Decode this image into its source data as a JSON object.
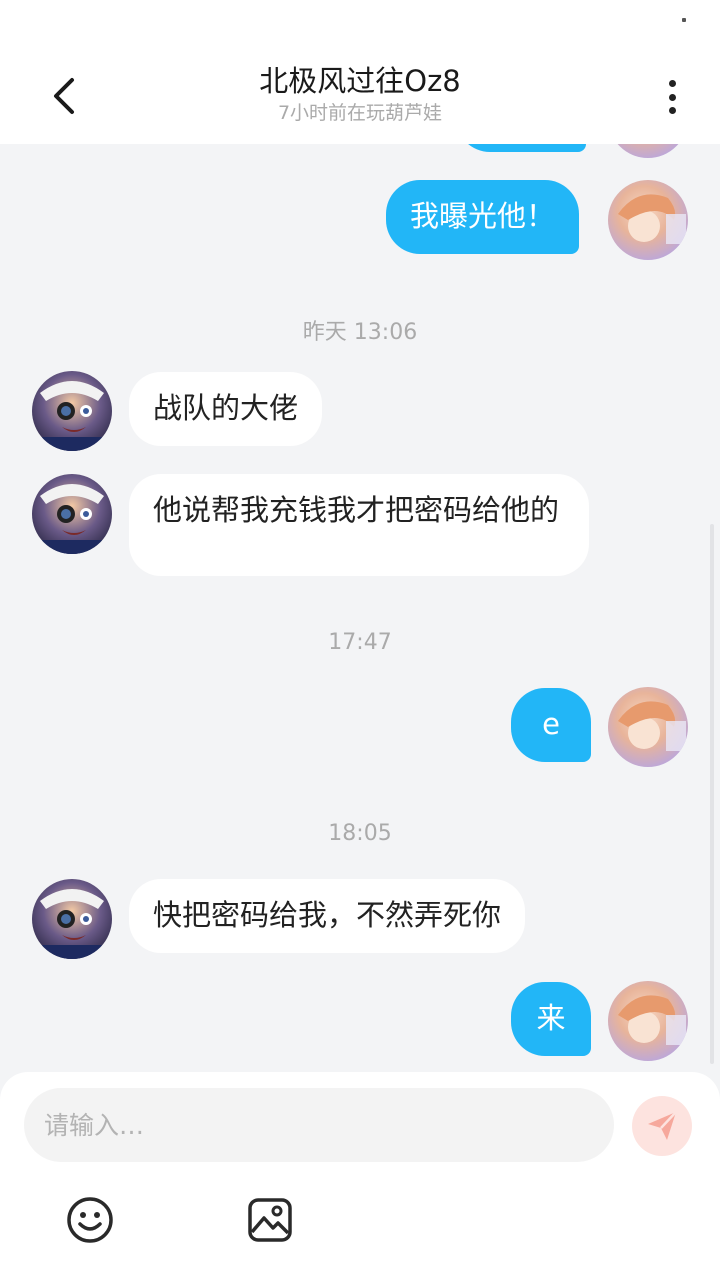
{
  "header": {
    "title": "北极风过往Oz8",
    "subtitle": "7小时前在玩葫芦娃",
    "back_icon": "chevron-left-icon",
    "more_icon": "more-vertical-icon"
  },
  "messages": [
    {
      "side": "out",
      "text": "我曝光他！"
    },
    {
      "side": "in",
      "text": "战队的大佬"
    },
    {
      "side": "in",
      "text": "他说帮我充钱我才把密码给他的"
    },
    {
      "side": "out",
      "text": "e"
    },
    {
      "side": "in",
      "text": "快把密码给我，不然弄死你"
    },
    {
      "side": "out",
      "text": "来"
    }
  ],
  "timestamps": [
    "昨天 13:06",
    "17:47",
    "18:05"
  ],
  "input": {
    "placeholder": "请输入…",
    "value": ""
  },
  "toolbar": {
    "send_icon": "send-icon",
    "emoji_icon": "emoji-icon",
    "image_icon": "image-icon"
  },
  "colors": {
    "outgoing_bubble": "#22b6f7",
    "incoming_bubble": "#ffffff",
    "background": "#f3f4f6",
    "send_button": "#fde3df",
    "send_icon": "#f6a89c"
  }
}
